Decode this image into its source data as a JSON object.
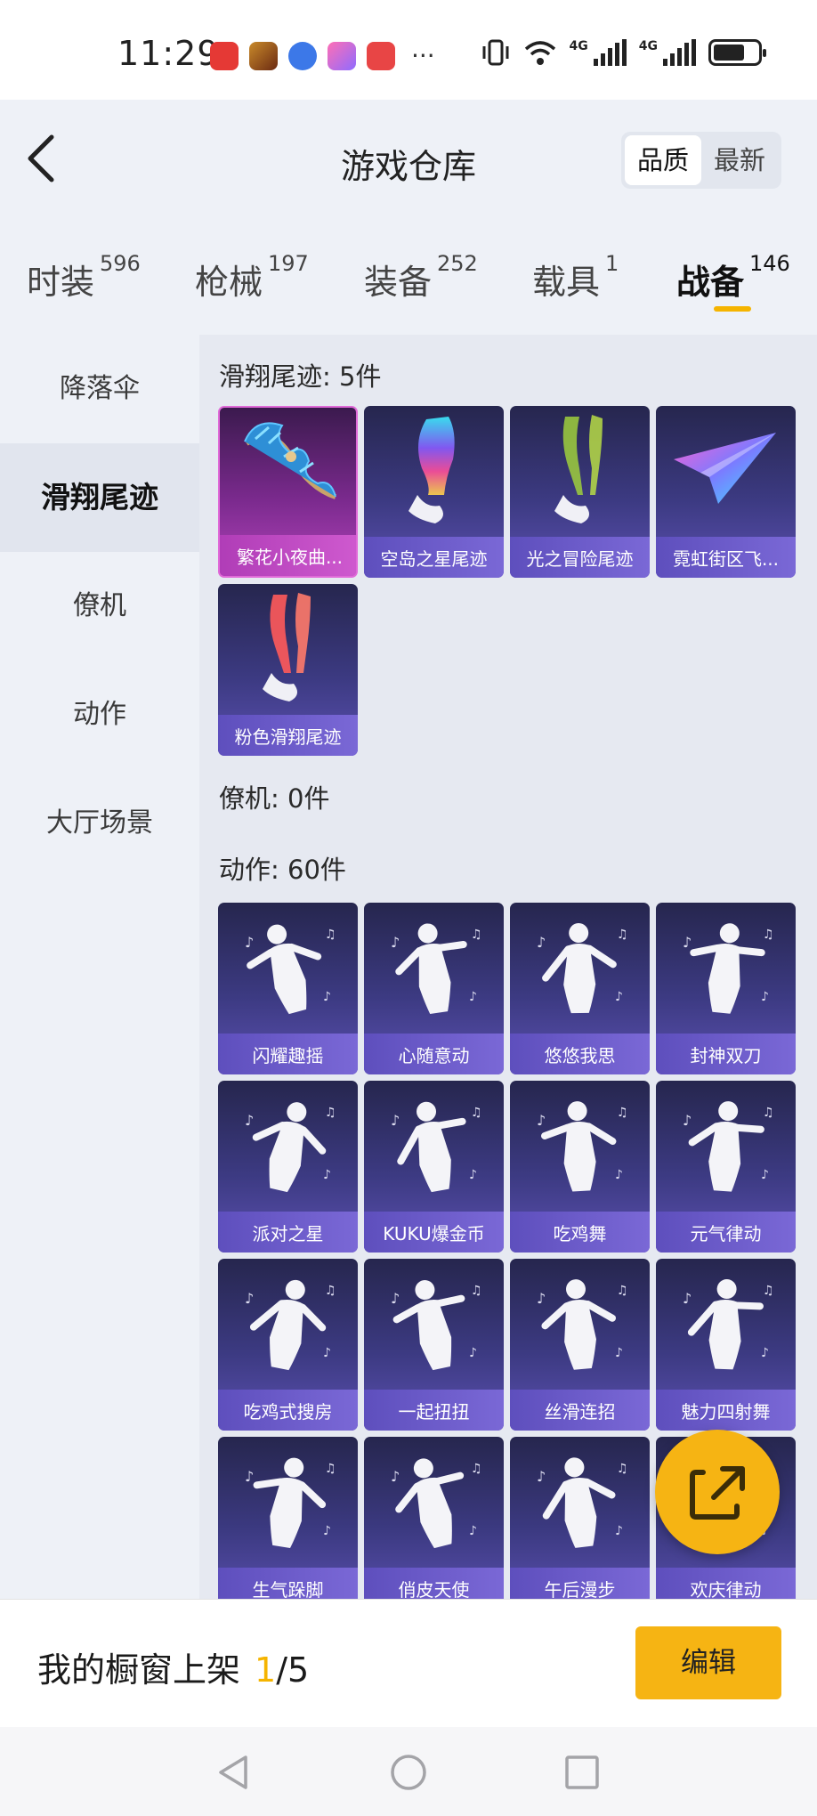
{
  "status_bar": {
    "time": "11:29",
    "dots": "···",
    "network_1": "4G",
    "network_2": "4G",
    "app_icons": [
      "huawei-store-icon",
      "game-avatar-icon",
      "music-icon",
      "app-i-icon",
      "book-icon"
    ]
  },
  "header": {
    "title": "游戏仓库",
    "sort_options": [
      "品质",
      "最新"
    ],
    "sort_selected": "品质"
  },
  "category_tabs": [
    {
      "label": "时装",
      "count": "596"
    },
    {
      "label": "枪械",
      "count": "197"
    },
    {
      "label": "装备",
      "count": "252"
    },
    {
      "label": "载具",
      "count": "1"
    },
    {
      "label": "战备",
      "count": "146",
      "active": true
    }
  ],
  "sidebar": {
    "items": [
      "降落伞",
      "滑翔尾迹",
      "僚机",
      "动作",
      "大厅场景"
    ],
    "selected": "滑翔尾迹"
  },
  "sections": {
    "glide_trail_title": "滑翔尾迹: 5件",
    "wingman_title": "僚机: 0件",
    "emote_title": "动作: 60件"
  },
  "glide_trails": [
    {
      "name": "繁花小夜曲...",
      "art": "feather-wings"
    },
    {
      "name": "空岛之星尾迹",
      "art": "rainbow-smoke"
    },
    {
      "name": "光之冒险尾迹",
      "art": "green-smoke"
    },
    {
      "name": "霓虹街区飞...",
      "art": "neon-paper-plane"
    },
    {
      "name": "粉色滑翔尾迹",
      "art": "pink-smoke"
    }
  ],
  "emotes": [
    {
      "name": "闪耀趣摇"
    },
    {
      "name": "心随意动"
    },
    {
      "name": "悠悠我思"
    },
    {
      "name": "封神双刀"
    },
    {
      "name": "派对之星"
    },
    {
      "name": "KUKU爆金币"
    },
    {
      "name": "吃鸡舞"
    },
    {
      "name": "元气律动"
    },
    {
      "name": "吃鸡式搜房"
    },
    {
      "name": "一起扭扭"
    },
    {
      "name": "丝滑连招"
    },
    {
      "name": "魅力四射舞"
    },
    {
      "name": "生气跺脚"
    },
    {
      "name": "俏皮天使"
    },
    {
      "name": "午后漫步"
    },
    {
      "name": "欢庆律动"
    }
  ],
  "bottom_bar": {
    "shelf_label": "我的橱窗上架",
    "shelf_current": "1",
    "shelf_total": "/5",
    "edit_label": "编辑"
  },
  "colors": {
    "accent": "#f6b413",
    "card_top": "#26264e",
    "card_bottom": "#5b50b0",
    "pink_card": "#b143b9"
  }
}
